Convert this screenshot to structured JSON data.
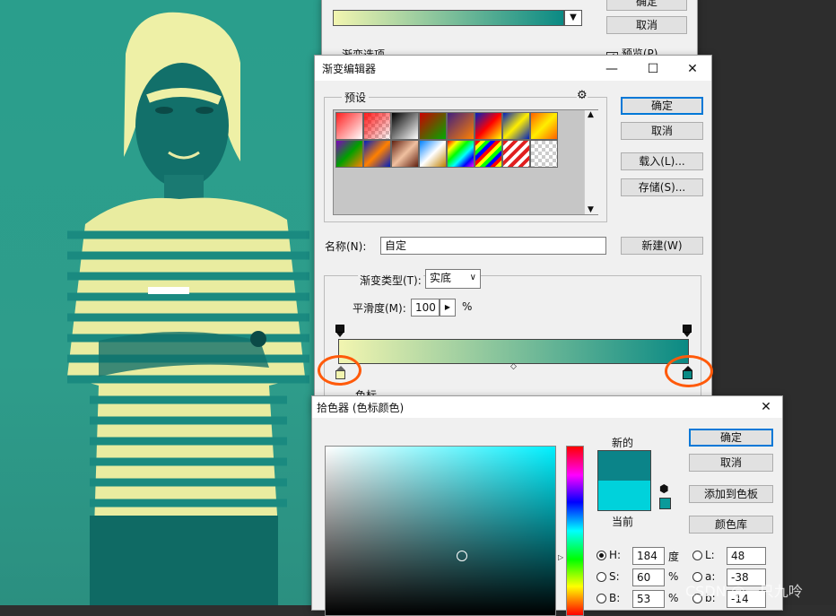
{
  "back_dialog": {
    "ok_label": "确定",
    "cancel_label": "取消",
    "preview_label": "预览(P)",
    "options_label": "渐变选项"
  },
  "gradient_editor": {
    "title": "渐变编辑器",
    "presets_label": "预设",
    "ok_label": "确定",
    "cancel_label": "取消",
    "load_label": "载入(L)...",
    "save_label": "存储(S)...",
    "name_label": "名称(N):",
    "name_value": "自定",
    "new_label": "新建(W)",
    "type_label": "渐变类型(T):",
    "type_value": "实底",
    "smooth_label": "平滑度(M):",
    "smooth_value": "100",
    "percent": "%",
    "color_stop_label": "色标",
    "gradient_start": "#f2f5b0",
    "gradient_end": "#0a8a84"
  },
  "color_picker": {
    "title": "拾色器 (色标颜色)",
    "ok_label": "确定",
    "cancel_label": "取消",
    "add_swatch_label": "添加到色板",
    "library_label": "颜色库",
    "new_label": "新的",
    "current_label": "当前",
    "new_color": "#0b8489",
    "current_color": "#00d2db",
    "fields": {
      "H": {
        "label": "H:",
        "value": "184",
        "unit": "度"
      },
      "S": {
        "label": "S:",
        "value": "60",
        "unit": "%"
      },
      "B": {
        "label": "B:",
        "value": "53",
        "unit": "%"
      },
      "L": {
        "label": "L:",
        "value": "48"
      },
      "a": {
        "label": "a:",
        "value": "-38"
      },
      "b": {
        "label": "b:",
        "value": "-14"
      }
    },
    "hue_color": "#00f0ff"
  },
  "watermark": "CSDN @一只九呤"
}
